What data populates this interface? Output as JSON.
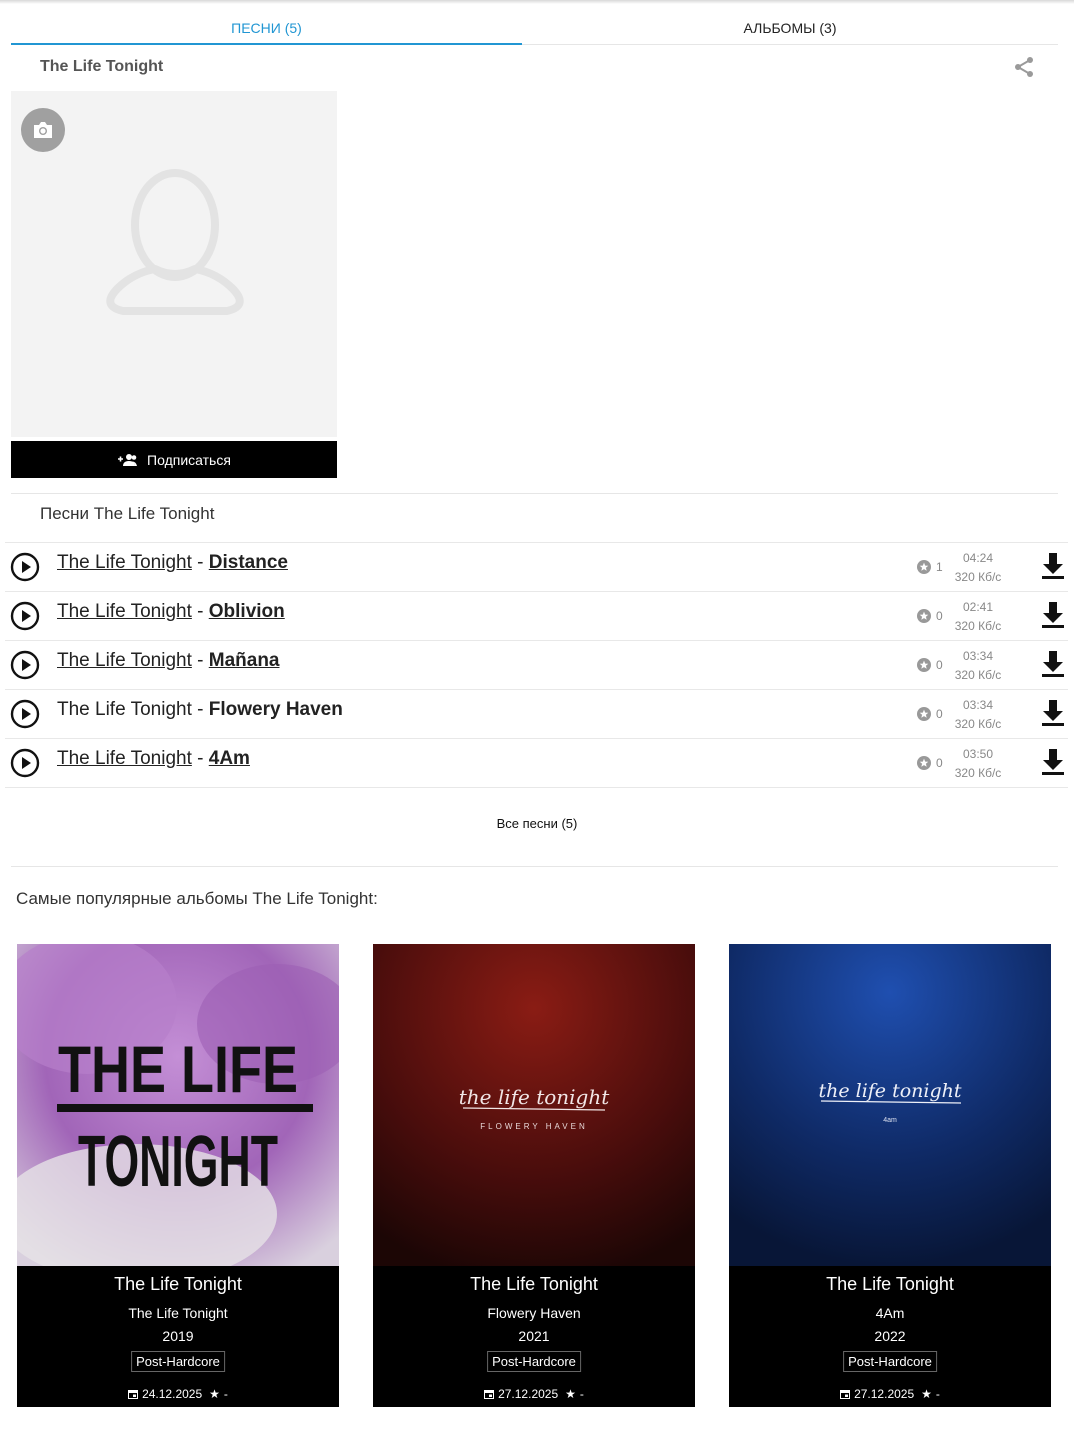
{
  "tabs": [
    {
      "label": "ПЕСНИ (5)",
      "active": true
    },
    {
      "label": "АЛЬБОМЫ (3)",
      "active": false
    }
  ],
  "artist": {
    "name": "The Life Tonight",
    "subscribe_label": "Подписаться"
  },
  "songs_heading": "Песни The Life Tonight",
  "songs": [
    {
      "artist": "The Life Tonight",
      "separator": "-",
      "title": "Distance",
      "rating": "1",
      "duration": "04:24",
      "bitrate": "320 Кб/с"
    },
    {
      "artist": "The Life Tonight",
      "separator": "-",
      "title": "Oblivion",
      "rating": "0",
      "duration": "02:41",
      "bitrate": "320 Кб/с"
    },
    {
      "artist": "The Life Tonight",
      "separator": "-",
      "title": "Mañana",
      "rating": "0",
      "duration": "03:34",
      "bitrate": "320 Кб/с"
    },
    {
      "artist": "The Life Tonight",
      "separator": "-",
      "title": "Flowery Haven",
      "rating": "0",
      "duration": "03:34",
      "bitrate": "320 Кб/с"
    },
    {
      "artist": "The Life Tonight",
      "separator": "-",
      "title": "4Am",
      "rating": "0",
      "duration": "03:50",
      "bitrate": "320 Кб/с"
    }
  ],
  "all_songs_label": "Все песни (5)",
  "albums_heading": "Самые популярные альбомы The Life Tonight:",
  "albums": [
    {
      "artist": "The Life Tonight",
      "album": "The Life Tonight",
      "year": "2019",
      "genre": "Post-Hardcore",
      "date": "24.12.2025",
      "rating": "-",
      "cover_text_1": "THE LIFE",
      "cover_text_2": "TONIGHT"
    },
    {
      "artist": "The Life Tonight",
      "album": "Flowery Haven",
      "year": "2021",
      "genre": "Post-Hardcore",
      "date": "27.12.2025",
      "rating": "-",
      "cover_script": "the life tonight",
      "cover_sub": "FLOWERY HAVEN"
    },
    {
      "artist": "The Life Tonight",
      "album": "4Am",
      "year": "2022",
      "genre": "Post-Hardcore",
      "date": "27.12.2025",
      "rating": "-",
      "cover_script": "the life tonight",
      "cover_sub": "4am"
    }
  ],
  "colors": {
    "accent": "#2196d3",
    "button_bg": "#000000",
    "muted": "#888888"
  }
}
